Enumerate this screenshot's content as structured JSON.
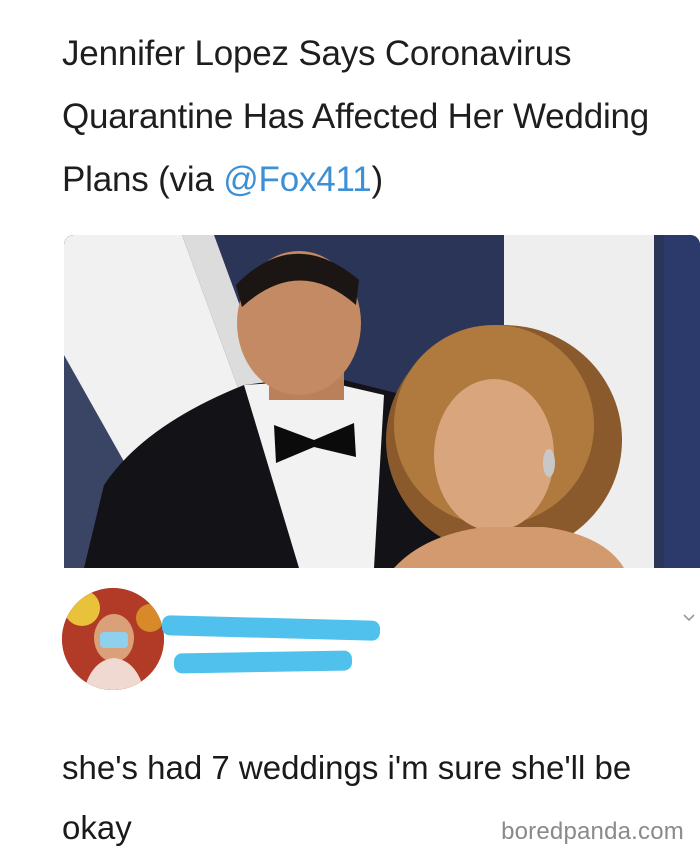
{
  "tweet": {
    "headline_text": "Jennifer Lopez Says Coronavirus Quarantine Has Affected Her Wedding Plans (via ",
    "mention": "@Fox411",
    "headline_close": ")"
  },
  "reply": {
    "text": "she's had 7 weddings i'm sure she'll be okay",
    "handle_peek": "@...",
    "redaction_color": "#4fc1ec"
  },
  "watermark": "boredpanda.com",
  "colors": {
    "link": "#3d8fd6",
    "text": "#1c1c1c"
  }
}
